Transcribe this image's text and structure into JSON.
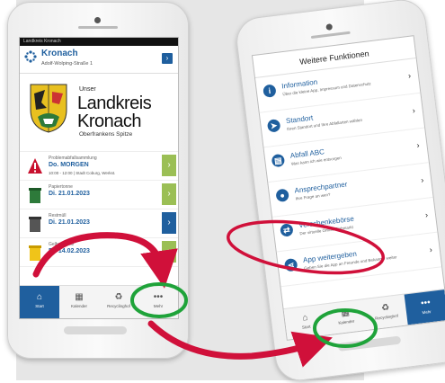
{
  "phone_left": {
    "status_text": "Landkreis Kronach",
    "header": {
      "city": "Kronach",
      "address": "Adolf-Wolping-Straße 1",
      "button_icon": "chevron-right-icon"
    },
    "banner": {
      "unser": "Unser",
      "landkreis": "Landkreis",
      "kronach": "Kronach",
      "tagline": "Oberfrankens Spitze"
    },
    "entries": [
      {
        "icon": "warning-icon",
        "kind": "Problemabfallsammlung",
        "date": "Do. MORGEN",
        "details": "10:00 - 12:00 | Stadt Coburg, Werkst."
      },
      {
        "icon": "paper-bin-icon",
        "kind": "Papiertonne",
        "date": "Di. 21.01.2023",
        "details": ""
      },
      {
        "icon": "residual-bin-icon",
        "kind": "Restmüll",
        "date": "Di. 21.01.2023",
        "details": ""
      },
      {
        "icon": "yellow-bag-icon",
        "kind": "Gelbe Tonne",
        "date": "Di. 14.02.2023",
        "details": ""
      }
    ],
    "nav": [
      {
        "icon": "home-icon",
        "label": "Start"
      },
      {
        "icon": "calendar-icon",
        "label": "Kalender"
      },
      {
        "icon": "recycle-icon",
        "label": "Recyclinghof"
      },
      {
        "icon": "more-icon",
        "label": "Mehr"
      }
    ]
  },
  "phone_right": {
    "title": "Weitere Funktionen",
    "items": [
      {
        "icon": "info-icon",
        "title": "Information",
        "subtitle": "Über die kleine App, Impressum und Datenschutz"
      },
      {
        "icon": "location-icon",
        "title": "Standort",
        "subtitle": "Ihren Standort und Ihre Abfallarten wählen"
      },
      {
        "icon": "book-icon",
        "title": "Abfall ABC",
        "subtitle": "Was kann ich wie entsorgen"
      },
      {
        "icon": "person-icon",
        "title": "Ansprechpartner",
        "subtitle": "Ihre Frage an wen?"
      },
      {
        "icon": "exchange-icon",
        "title": "Verschenkebörse",
        "subtitle": "Der virtuelle Online-Flohmarkt"
      },
      {
        "icon": "share-icon",
        "title": "App weitergeben",
        "subtitle": "Geben Sie die App an Freunde und Bekannte weiter"
      }
    ],
    "nav": [
      {
        "icon": "home-icon",
        "label": "Start"
      },
      {
        "icon": "calendar-icon",
        "label": "Kalender"
      },
      {
        "icon": "recycle-icon",
        "label": "Recyclinghof"
      },
      {
        "icon": "more-icon",
        "label": "Mehr"
      }
    ]
  },
  "colors": {
    "brand_blue": "#1f5f9e",
    "annotation_red": "#d0103a",
    "annotation_green": "#1fa33a",
    "bin_green": "#9bbf55"
  }
}
